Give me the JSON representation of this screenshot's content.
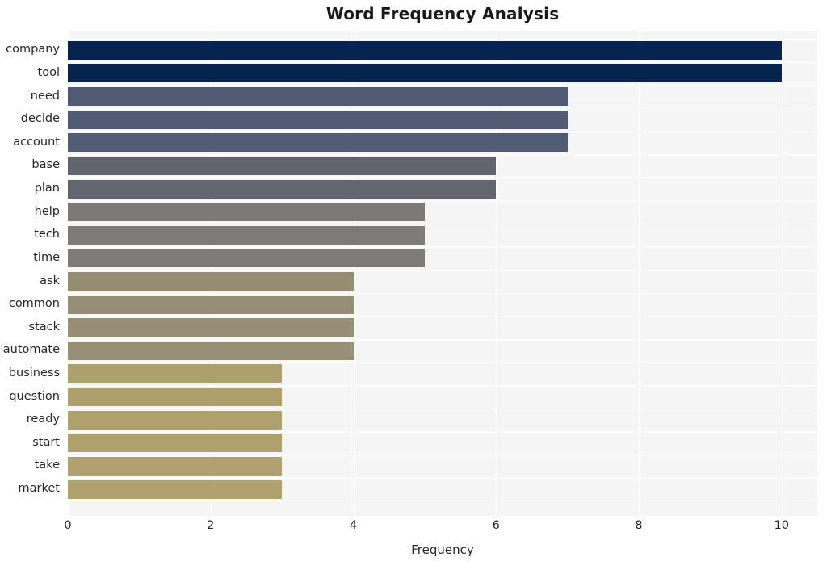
{
  "chart_data": {
    "type": "bar",
    "orientation": "horizontal",
    "title": "Word Frequency Analysis",
    "xlabel": "Frequency",
    "ylabel": "",
    "categories": [
      "company",
      "tool",
      "need",
      "decide",
      "account",
      "base",
      "plan",
      "help",
      "tech",
      "time",
      "ask",
      "common",
      "stack",
      "automate",
      "business",
      "question",
      "ready",
      "start",
      "take",
      "market"
    ],
    "values": [
      10,
      10,
      7,
      7,
      7,
      6,
      6,
      5,
      5,
      5,
      4,
      4,
      4,
      4,
      3,
      3,
      3,
      3,
      3,
      3
    ],
    "bar_colors": [
      "#06244d",
      "#06254e",
      "#505a73",
      "#515b74",
      "#525c75",
      "#63656e",
      "#64666f",
      "#7b7a78",
      "#7c7b79",
      "#7d7c7a",
      "#948d74",
      "#958e75",
      "#968f76",
      "#979076",
      "#aea06c",
      "#aea06c",
      "#afa16d",
      "#afa16d",
      "#b0a26e",
      "#b0a26e"
    ],
    "xlim": [
      0,
      10.5
    ],
    "xticks": [
      0,
      2,
      4,
      6,
      8,
      10
    ],
    "xtick_labels": [
      "0",
      "2",
      "4",
      "6",
      "8",
      "10"
    ],
    "grid": true,
    "grid_color": "#ffffff",
    "plot_background": "#f5f5f6",
    "figure_background": "#ffffff",
    "legend": null,
    "annotations": []
  },
  "axis": {
    "title_color": "#1a1a1a",
    "tick_color": "#262626"
  }
}
